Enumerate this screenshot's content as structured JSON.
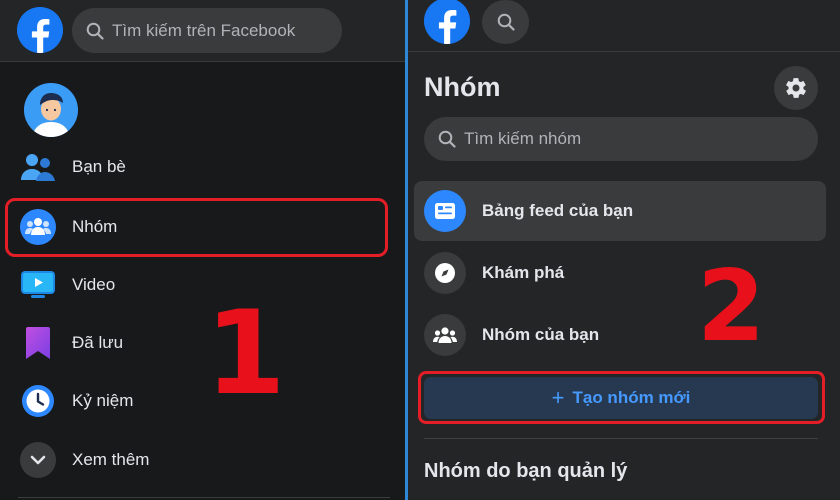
{
  "left": {
    "search_placeholder": "Tìm kiếm trên Facebook",
    "menu": [
      {
        "label": "Bạn bè",
        "icon": "friends-icon"
      },
      {
        "label": "Nhóm",
        "icon": "groups-icon"
      },
      {
        "label": "Video",
        "icon": "video-icon"
      },
      {
        "label": "Đã lưu",
        "icon": "saved-bookmark-icon"
      },
      {
        "label": "Kỷ niệm",
        "icon": "memories-clock-icon"
      },
      {
        "label": "Xem thêm",
        "icon": "chevron-down-icon"
      }
    ],
    "step_number": "1"
  },
  "right": {
    "title": "Nhóm",
    "search_placeholder": "Tìm kiếm nhóm",
    "nav": [
      {
        "label": "Bảng feed của bạn",
        "icon": "feed-icon"
      },
      {
        "label": "Khám phá",
        "icon": "compass-icon"
      },
      {
        "label": "Nhóm của bạn",
        "icon": "your-groups-icon"
      }
    ],
    "create_button": {
      "plus": "+",
      "label": "Tạo nhóm mới"
    },
    "managed_title": "Nhóm do bạn quản lý",
    "step_number": "2"
  },
  "colors": {
    "brand": "#1877f2",
    "accent_blue": "#2d88ff",
    "highlight_red": "#e41e26",
    "background_dark": "#18191a",
    "panel_dark": "#242526"
  }
}
